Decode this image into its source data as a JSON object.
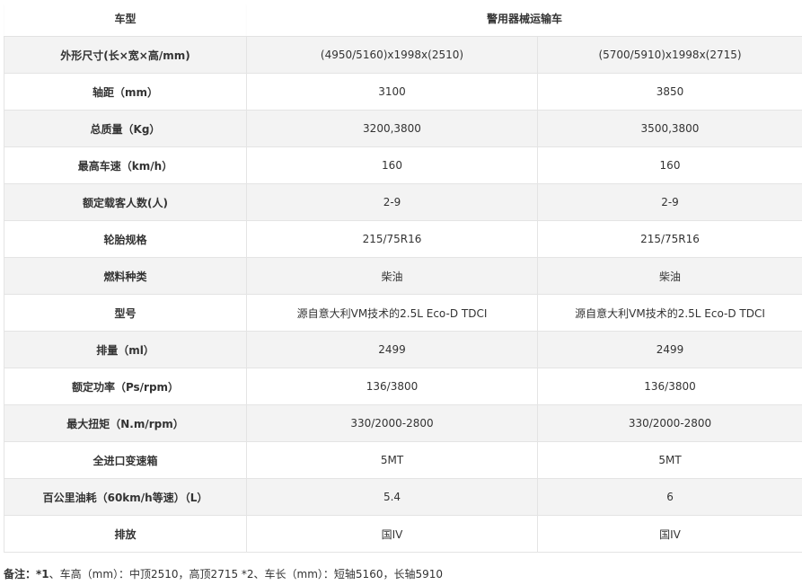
{
  "table": {
    "header": {
      "col1": "车型",
      "col2": "警用器械运输车",
      "col3": ""
    },
    "rows": [
      {
        "label": "外形尺寸(长×宽×高/mm)",
        "v1": "(4950/5160)x1998x(2510)",
        "v2": "(5700/5910)x1998x(2715)"
      },
      {
        "label": "轴距（mm）",
        "v1": "3100",
        "v2": "3850"
      },
      {
        "label": "总质量（Kg）",
        "v1": "3200,3800",
        "v2": "3500,3800"
      },
      {
        "label": "最高车速（km/h）",
        "v1": "160",
        "v2": "160"
      },
      {
        "label": "额定载客人数(人)",
        "v1": "2-9",
        "v2": "2-9"
      },
      {
        "label": "轮胎规格",
        "v1": "215/75R16",
        "v2": "215/75R16"
      },
      {
        "label": "燃料种类",
        "v1": "柴油",
        "v2": "柴油"
      },
      {
        "label": "型号",
        "v1": "源自意大利VM技术的2.5L Eco-D TDCI",
        "v2": "源自意大利VM技术的2.5L Eco-D TDCI"
      },
      {
        "label": "排量（ml）",
        "v1": "2499",
        "v2": "2499"
      },
      {
        "label": "额定功率（Ps/rpm）",
        "v1": "136/3800",
        "v2": "136/3800"
      },
      {
        "label": "最大扭矩（N.m/rpm）",
        "v1": "330/2000-2800",
        "v2": "330/2000-2800"
      },
      {
        "label": "全进口变速箱",
        "v1": "5MT",
        "v2": "5MT"
      },
      {
        "label": "百公里油耗（60km/h等速）（L）",
        "v1": "5.4",
        "v2": "6"
      },
      {
        "label": "排放",
        "v1": "国IV",
        "v2": "国IV"
      }
    ]
  },
  "note": {
    "prefix": "备注：*1",
    "text": "、车高（mm）：中顶2510，高顶2715 *2、车长（mm）：短轴5160，长轴5910"
  }
}
